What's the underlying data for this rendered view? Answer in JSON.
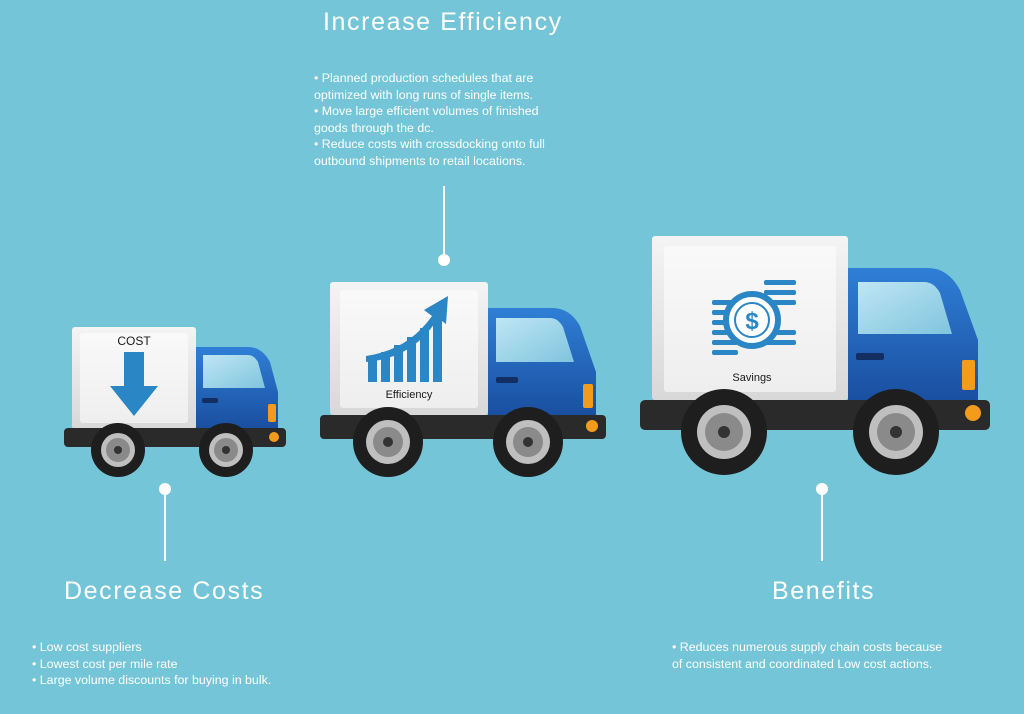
{
  "sections": {
    "efficiency": {
      "title": "Increase Efficiency",
      "bullets": [
        "Planned production schedules that are",
        "optimized with long runs of single items.",
        "Move large efficient volumes of finished",
        "goods through the dc.",
        "Reduce costs with crossdocking onto full",
        "outbound shipments to retail locations."
      ]
    },
    "costs": {
      "title": "Decrease Costs",
      "bullets": [
        "Low cost suppliers",
        "Lowest cost per mile rate",
        "Large volume discounts for buying in bulk."
      ]
    },
    "benefits": {
      "title": "Benefits",
      "bullets": [
        "Reduces numerous supply chain costs because",
        "of consistent and coordinated Low cost actions."
      ]
    }
  },
  "trucks": {
    "small": {
      "label": "COST",
      "icon": "down-arrow-icon"
    },
    "medium": {
      "label": "Efficiency",
      "icon": "growth-chart-icon"
    },
    "large": {
      "label": "Savings",
      "icon": "dollar-coins-icon"
    }
  },
  "colors": {
    "background": "#75c5d8",
    "truck_blue": "#1f63b8",
    "icon_blue": "#2a86c4",
    "box": "#e6e6e6",
    "chassis": "#2a2a2a",
    "light": "#f39c1c"
  }
}
